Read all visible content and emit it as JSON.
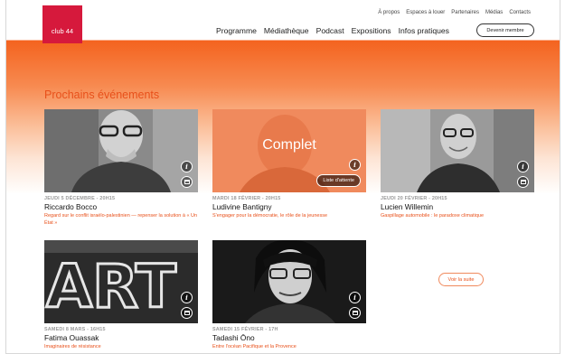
{
  "header": {
    "logo_text": "club 44",
    "utility_nav": [
      "À propos",
      "Espaces à louer",
      "Partenaires",
      "Médias",
      "Contacts"
    ],
    "main_nav": [
      "Programme",
      "Médiathèque",
      "Podcast",
      "Expositions",
      "Infos pratiques"
    ],
    "member_button": "Devenir membre"
  },
  "section_title": "Prochains événements",
  "events": [
    {
      "date": "JEUDI 5 DÉCEMBRE - 20H15",
      "name": "Riccardo Bocco",
      "subtitle": "Regard sur le conflit israélo-palestinien — repenser la solution à « Un État »"
    },
    {
      "date": "MARDI 18 FÉVRIER - 20H15",
      "name": "Ludivine Bantigny",
      "subtitle": "S'engager pour la démocratie, le rôle de la jeunesse",
      "overlay": "Complet",
      "waitlist_button": "Liste d'attente"
    },
    {
      "date": "JEUDI 20 FÉVRIER - 20H15",
      "name": "Lucien Willemin",
      "subtitle": "Gaspillage automobile : le paradoxe climatique"
    },
    {
      "date": "SAMEDI 8 MARS - 16H15",
      "name": "Fatima Ouassak",
      "subtitle": "Imaginaires de résistance",
      "image_text": "ART"
    },
    {
      "date": "SAMEDI 15 FÉVRIER - 17H",
      "name": "Tadashi Ōno",
      "subtitle": "Entre l'océan Pacifique et la Provence"
    }
  ],
  "see_more_button": "Voir la suite",
  "colors": {
    "brand_red": "#d6193c",
    "accent_orange": "#e8501a",
    "banner_orange": "#f4631f"
  }
}
